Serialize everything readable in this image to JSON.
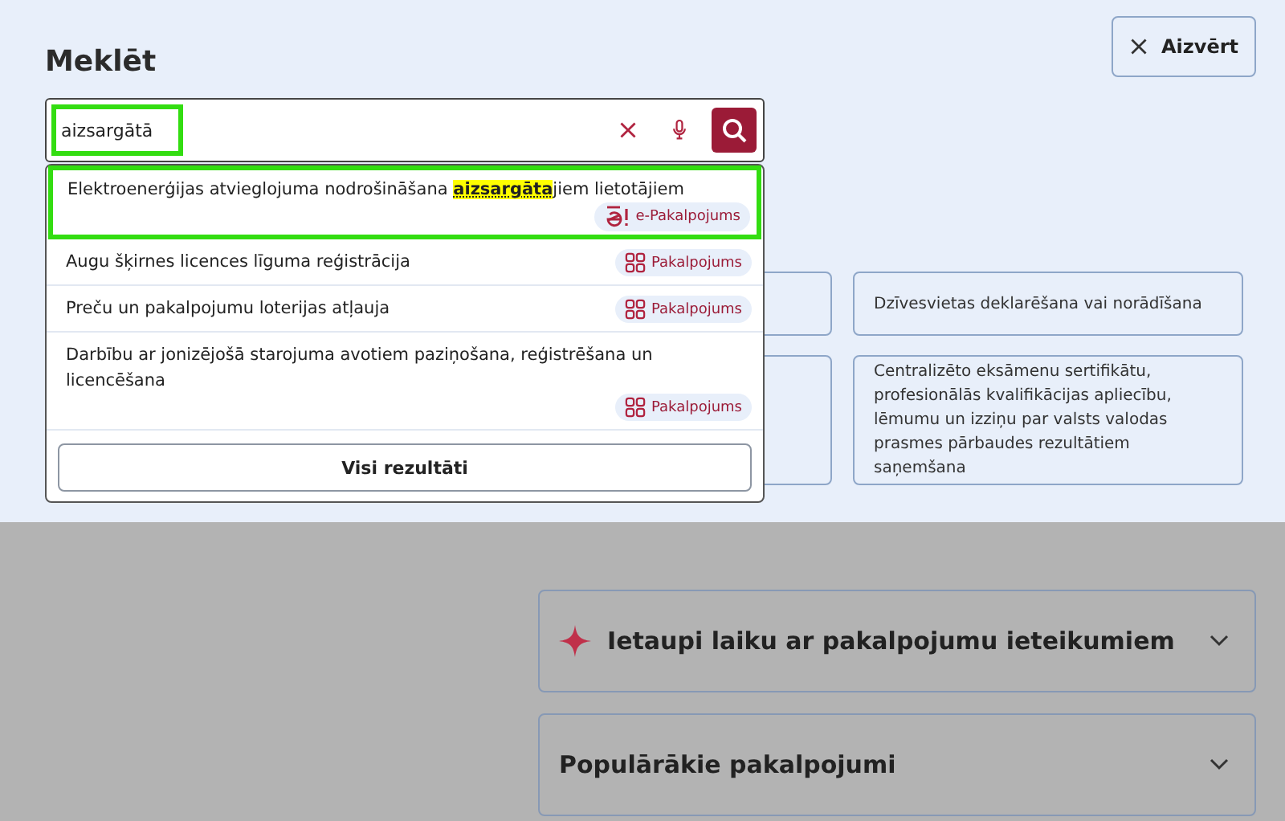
{
  "title": "Meklēt",
  "close_button": {
    "label": "Aizvērt"
  },
  "search": {
    "value": "aizsargātā",
    "highlighted": true
  },
  "suggestions": [
    {
      "text": "Elektroenerģijas atvieglojuma nodrošināšana **aizsargāta**jiem lietotājiem",
      "badge": "e-Pakalpojums",
      "kind": "eservice",
      "highlighted": true
    },
    {
      "text": "Augu šķirnes licences līguma reģistrācija",
      "badge": "Pakalpojums",
      "kind": "service",
      "highlighted": false
    },
    {
      "text": "Preču un pakalpojumu loterijas atļauja",
      "badge": "Pakalpojums",
      "kind": "service",
      "highlighted": false
    },
    {
      "text": "Darbību ar jonizējošā starojuma avotiem paziņošana, reģistrēšana un licencēšana",
      "badge": "Pakalpojums",
      "kind": "service",
      "highlighted": false
    }
  ],
  "all_results_button": "Visi rezultāti",
  "service_cards": [
    "Dzīvesvietas deklarēšana vai norādīšana",
    "Centralizēto eksāmenu sertifikātu, profesionālās kvalifikācijas apliecību, lēmumu un izziņu par valsts valodas prasmes pārbaudes rezultātiem saņemšana"
  ],
  "accordions": [
    {
      "title": "Ietaupi laiku ar pakalpojumu ieteikumiem",
      "kind": "sparkle",
      "expanded": false
    },
    {
      "title": "Populārākie pakalpojumi",
      "kind": "plain",
      "expanded": false
    }
  ]
}
